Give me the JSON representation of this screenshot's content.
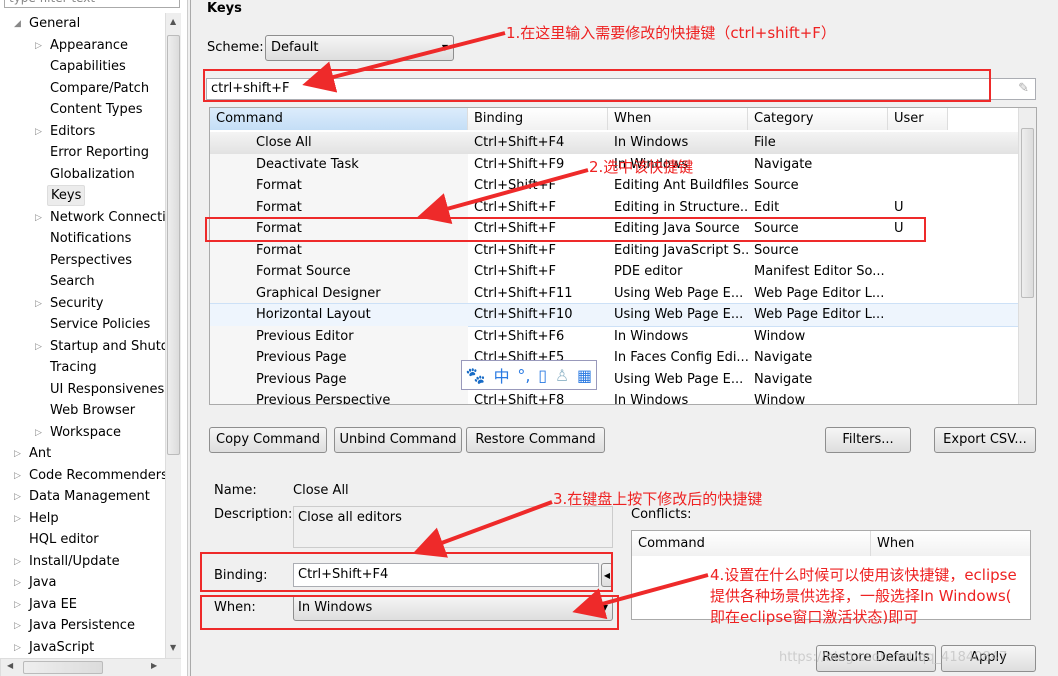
{
  "sidebar": {
    "filter_placeholder": "type filter text",
    "items": [
      {
        "label": "General",
        "level": 0,
        "expanded": true
      },
      {
        "label": "Appearance",
        "level": 1,
        "expandable": true
      },
      {
        "label": "Capabilities",
        "level": 1
      },
      {
        "label": "Compare/Patch",
        "level": 1
      },
      {
        "label": "Content Types",
        "level": 1
      },
      {
        "label": "Editors",
        "level": 1,
        "expandable": true
      },
      {
        "label": "Error Reporting",
        "level": 1
      },
      {
        "label": "Globalization",
        "level": 1
      },
      {
        "label": "Keys",
        "level": 1,
        "selected": true
      },
      {
        "label": "Network Connectio",
        "level": 1,
        "expandable": true
      },
      {
        "label": "Notifications",
        "level": 1
      },
      {
        "label": "Perspectives",
        "level": 1
      },
      {
        "label": "Search",
        "level": 1
      },
      {
        "label": "Security",
        "level": 1,
        "expandable": true
      },
      {
        "label": "Service Policies",
        "level": 1
      },
      {
        "label": "Startup and Shutd",
        "level": 1,
        "expandable": true
      },
      {
        "label": "Tracing",
        "level": 1
      },
      {
        "label": "UI Responsiveness",
        "level": 1
      },
      {
        "label": "Web Browser",
        "level": 1
      },
      {
        "label": "Workspace",
        "level": 1,
        "expandable": true
      },
      {
        "label": "Ant",
        "level": 0,
        "expandable": true
      },
      {
        "label": "Code Recommenders",
        "level": 0,
        "expandable": true
      },
      {
        "label": "Data Management",
        "level": 0,
        "expandable": true
      },
      {
        "label": "Help",
        "level": 0,
        "expandable": true
      },
      {
        "label": "HQL editor",
        "level": 0
      },
      {
        "label": "Install/Update",
        "level": 0,
        "expandable": true
      },
      {
        "label": "Java",
        "level": 0,
        "expandable": true
      },
      {
        "label": "Java EE",
        "level": 0,
        "expandable": true
      },
      {
        "label": "Java Persistence",
        "level": 0,
        "expandable": true
      },
      {
        "label": "JavaScript",
        "level": 0,
        "expandable": true
      }
    ]
  },
  "page": {
    "title": "Keys",
    "scheme_label": "Scheme:",
    "scheme_value": "Default",
    "filter_value": "ctrl+shift+F"
  },
  "table": {
    "columns": [
      "Command",
      "Binding",
      "When",
      "Category",
      "User"
    ],
    "rows": [
      [
        "Close All",
        "Ctrl+Shift+F4",
        "In Windows",
        "File",
        ""
      ],
      [
        "Deactivate Task",
        "Ctrl+Shift+F9",
        "In Windows",
        "Navigate",
        ""
      ],
      [
        "Format",
        "Ctrl+Shift+F",
        "Editing Ant Buildfiles",
        "Source",
        ""
      ],
      [
        "Format",
        "Ctrl+Shift+F",
        "Editing in Structure...",
        "Edit",
        "U"
      ],
      [
        "Format",
        "Ctrl+Shift+F",
        "Editing Java Source",
        "Source",
        "U"
      ],
      [
        "Format",
        "Ctrl+Shift+F",
        "Editing JavaScript S...",
        "Source",
        ""
      ],
      [
        "Format Source",
        "Ctrl+Shift+F",
        "PDE editor",
        "Manifest Editor So...",
        ""
      ],
      [
        "Graphical Designer",
        "Ctrl+Shift+F11",
        "Using Web Page E...",
        "Web Page Editor L...",
        ""
      ],
      [
        "Horizontal Layout",
        "Ctrl+Shift+F10",
        "Using Web Page E...",
        "Web Page Editor L...",
        ""
      ],
      [
        "Previous Editor",
        "Ctrl+Shift+F6",
        "In Windows",
        "Window",
        ""
      ],
      [
        "Previous Page",
        "Ctrl+Shift+F5",
        "In Faces Config Edi...",
        "Navigate",
        ""
      ],
      [
        "Previous Page",
        "Ctrl+Shift+F7",
        "Using Web Page E...",
        "Navigate",
        ""
      ],
      [
        "Previous Perspective",
        "Ctrl+Shift+F8",
        "In Windows",
        "Window",
        ""
      ]
    ]
  },
  "buttons": {
    "copy": "Copy Command",
    "unbind": "Unbind Command",
    "restore": "Restore Command",
    "filters": "Filters...",
    "export": "Export CSV...",
    "restore_defaults": "Restore Defaults",
    "apply": "Apply"
  },
  "details": {
    "name_label": "Name:",
    "name_value": "Close All",
    "desc_label": "Description:",
    "desc_value": "Close all editors",
    "binding_label": "Binding:",
    "binding_value": "Ctrl+Shift+F4",
    "when_label": "When:",
    "when_value": "In Windows",
    "conflicts_label": "Conflicts:",
    "conflicts_columns": [
      "Command",
      "When"
    ]
  },
  "ime_toolbar": {
    "icons": [
      "paw-icon",
      "chinese-mode-icon",
      "punctuation-icon",
      "keyboard-icon",
      "user-icon",
      "grid-icon"
    ],
    "chinese_glyph": "中"
  },
  "annotations": {
    "a1": "1.在这里输入需要修改的快捷键（ctrl+shift+F）",
    "a2": "2.选中该快捷键",
    "a3": "3.在键盘上按下修改后的快捷键",
    "a4": [
      "4.设置在什么时候可以使用该快捷键，eclipse",
      "提供各种场景供选择，一般选择In Windows(",
      "即在eclipse窗口激活状态)即可"
    ],
    "color": "#ee2222"
  },
  "watermark": "https://blog.csdn.net/qq_41840847"
}
